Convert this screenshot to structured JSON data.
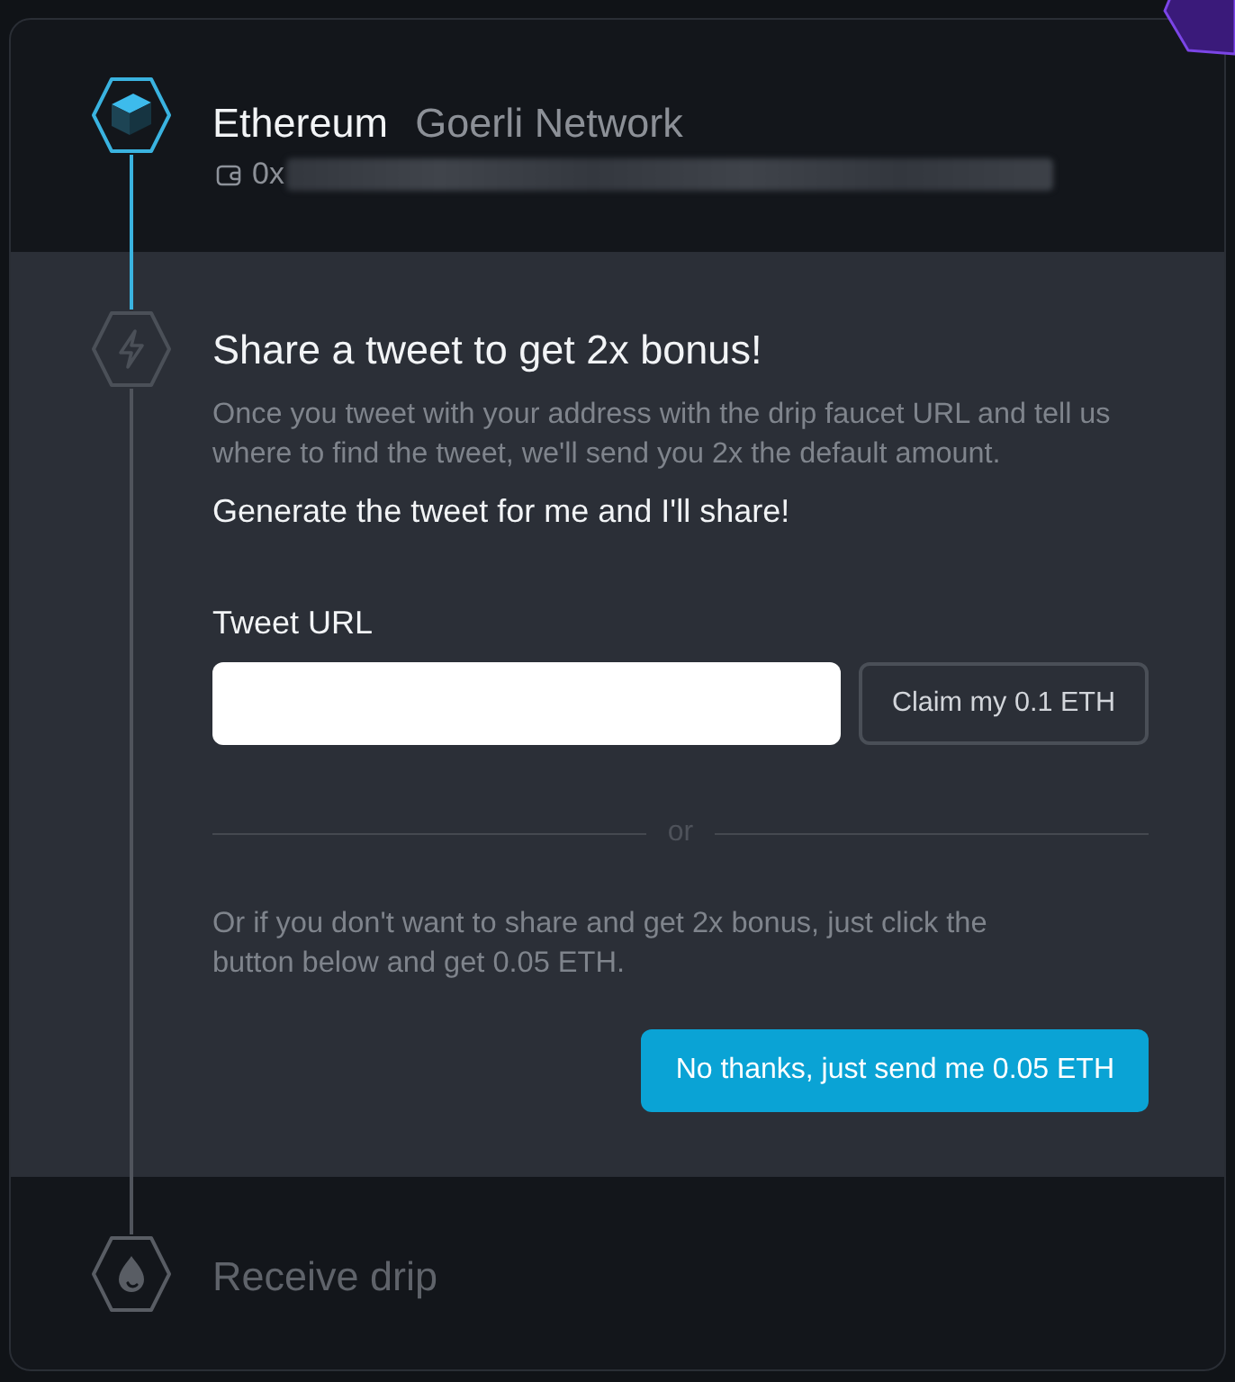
{
  "steps": [
    {
      "kind": "network",
      "completed": true,
      "active": false,
      "title": "Ethereum",
      "subtitle": "Goerli Network",
      "address_prefix": "0x",
      "address_blurred": true
    },
    {
      "kind": "bonus",
      "completed": false,
      "active": true,
      "title": "Share a tweet to get 2x bonus!",
      "description": "Once you tweet with your address with the drip faucet URL and tell us where to find the tweet, we'll send you 2x the default amount.",
      "generate_link": "Generate the tweet for me and I'll share!",
      "field": {
        "label": "Tweet URL"
      },
      "claim_button": "Claim my 0.1 ETH",
      "separator": "or",
      "alternative": "Or if you don't want to share and get 2x bonus, just click the button below and get 0.05 ETH.",
      "primary_button": "No thanks, just send me 0.05 ETH"
    },
    {
      "kind": "drip",
      "completed": false,
      "active": false,
      "title": "Receive drip"
    }
  ]
}
